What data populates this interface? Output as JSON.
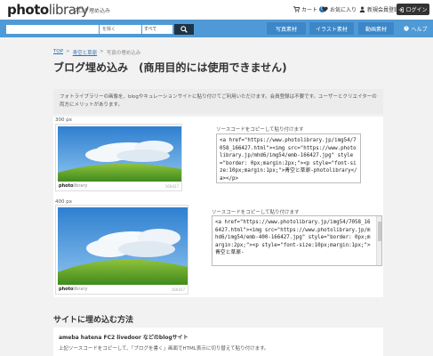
{
  "header": {
    "logo_main": "photo",
    "logo_sub": "library",
    "tagline": "ブログ埋め込み",
    "cart_label": "カート",
    "cart_count": "0",
    "favorites_label": "お気に入り",
    "register_label": "新規会員登録",
    "login_label": "ログイン"
  },
  "search": {
    "placeholder": "",
    "mode": "を除く",
    "category": "すべて"
  },
  "nav": {
    "photo": "写真素材",
    "illust": "イラスト素材",
    "video": "動画素材",
    "help": "ヘルプ"
  },
  "breadcrumb": {
    "top": "TOP",
    "category": "青空と草原",
    "current": "写真の埋め込み",
    "sep": ">"
  },
  "page_title": "ブログ埋め込み　(商用目的には使用できません)",
  "notice": "フォトライブラリーの画像を、blogやキュレーションサイトに貼り付けてご利用いただけます。会員登録は不要です。ユーザーとクリエイターの両方にメリットがあります。",
  "embeds": [
    {
      "size_label": "300 px",
      "copy_label": "ソースコードをコピーして貼り付けます",
      "code": "<a href=\"https://www.photolibrary.jp/img54/7058_166427.html\"><img src=\"https://www.photolibrary.jp/mhd6/img54/emb-166427.jpg\" style=\"border: 0px;margin:2px;\"><p style=\"font-size:10px;margin:1px;\">青空と草原-photolibrary</a></p>",
      "footer_logo": "photo",
      "footer_logo_sub": "library",
      "img_id": "166427"
    },
    {
      "size_label": "400 px",
      "copy_label": "ソースコードをコピーして貼り付けます",
      "code": "<a href=\"https://www.photolibrary.jp/img54/7058_166427.html\"><img src=\"https://www.photolibrary.jp/mhd6/img54/emb-400-166427.jpg\" style=\"border: 0px;margin:2px;\"><p style=\"font-size:10px;margin:1px;\">青空と草原-",
      "footer_logo": "photo",
      "footer_logo_sub": "library",
      "img_id": "166427"
    }
  ],
  "section_title": "サイトに埋め込む方法",
  "howto": {
    "title": "ameba hatena FC2 livedoor などのblogサイト",
    "text": "上記ソースコードをコピーして、「ブログを書く」画面でHTML表示に切り替えて貼り付けます。"
  },
  "colors": {
    "navbar": "#4f9ad6",
    "nav_button": "#3d87c7",
    "search_button": "#1d3447",
    "link": "#2a72b5"
  }
}
